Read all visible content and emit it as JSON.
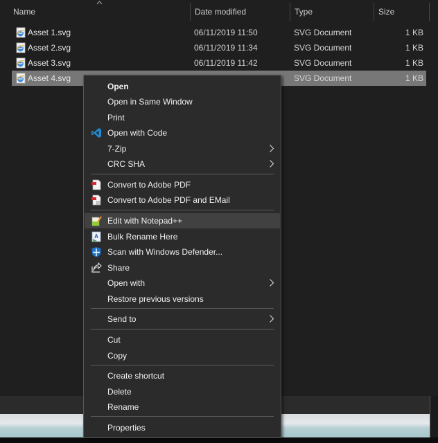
{
  "columns": {
    "name": "Name",
    "date": "Date modified",
    "type": "Type",
    "size": "Size"
  },
  "sort": {
    "column": "name",
    "direction": "ascending",
    "icon": "chevron-up-icon"
  },
  "files": [
    {
      "name": "Asset 1.svg",
      "date": "06/11/2019 11:50",
      "type": "SVG Document",
      "size": "1 KB",
      "icon": "svg-file-icon",
      "selected": false
    },
    {
      "name": "Asset 2.svg",
      "date": "06/11/2019 11:34",
      "type": "SVG Document",
      "size": "1 KB",
      "icon": "svg-file-icon",
      "selected": false
    },
    {
      "name": "Asset 3.svg",
      "date": "06/11/2019 11:42",
      "type": "SVG Document",
      "size": "1 KB",
      "icon": "svg-file-icon",
      "selected": false
    },
    {
      "name": "Asset 4.svg",
      "date": "",
      "type": "SVG Document",
      "size": "1 KB",
      "icon": "svg-file-icon",
      "selected": true
    }
  ],
  "context_menu": {
    "items": [
      {
        "label": "Open",
        "bold": true
      },
      {
        "label": "Open in Same Window"
      },
      {
        "label": "Print"
      },
      {
        "label": "Open with Code",
        "icon": "vscode-icon"
      },
      {
        "label": "7-Zip",
        "submenu": true
      },
      {
        "label": "CRC SHA",
        "submenu": true
      },
      {
        "label": "Convert to Adobe PDF",
        "icon": "adobe-pdf-icon"
      },
      {
        "label": "Convert to Adobe PDF and EMail",
        "icon": "adobe-pdf-email-icon"
      },
      {
        "label": "Edit with Notepad++",
        "icon": "notepadpp-icon",
        "hovered": true
      },
      {
        "label": "Bulk Rename Here",
        "icon": "bulk-rename-icon"
      },
      {
        "label": "Scan with Windows Defender...",
        "icon": "windows-defender-icon"
      },
      {
        "label": "Share",
        "icon": "share-icon"
      },
      {
        "label": "Open with",
        "submenu": true
      },
      {
        "label": "Restore previous versions"
      },
      {
        "label": "Send to",
        "submenu": true
      },
      {
        "label": "Cut"
      },
      {
        "label": "Copy"
      },
      {
        "label": "Create shortcut"
      },
      {
        "label": "Delete"
      },
      {
        "label": "Rename"
      },
      {
        "label": "Properties"
      }
    ]
  },
  "colors": {
    "background": "#1f1f1f",
    "selection": "#777777",
    "menu_bg": "#2b2b2b",
    "menu_hover": "#414141",
    "vscode_blue": "#1f8ad2",
    "defender_blue": "#1a73c8"
  }
}
